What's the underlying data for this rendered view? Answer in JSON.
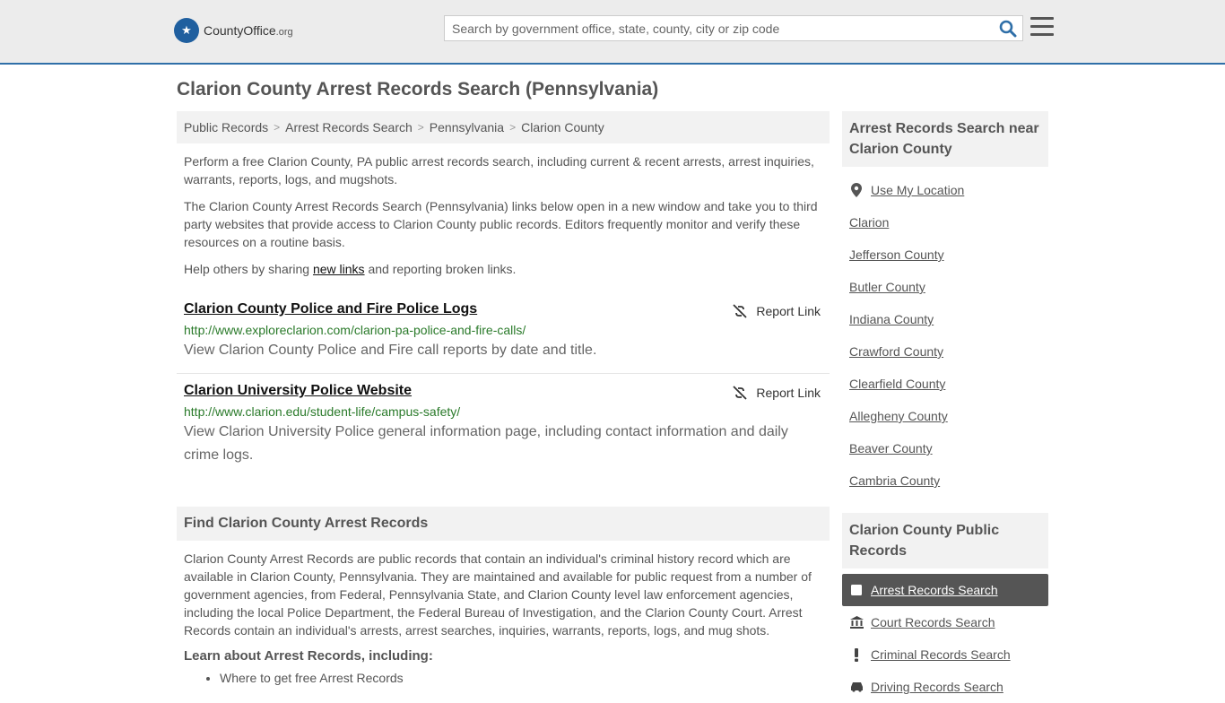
{
  "header": {
    "logo_name": "CountyOffice",
    "logo_tld": ".org",
    "search_placeholder": "Search by government office, state, county, city or zip code"
  },
  "page_title": "Clarion County Arrest Records Search (Pennsylvania)",
  "breadcrumbs": [
    "Public Records",
    "Arrest Records Search",
    "Pennsylvania",
    "Clarion County"
  ],
  "intro": {
    "p1": "Perform a free Clarion County, PA public arrest records search, including current & recent arrests, arrest inquiries, warrants, reports, logs, and mugshots.",
    "p2": "The Clarion County Arrest Records Search (Pennsylvania) links below open in a new window and take you to third party websites that provide access to Clarion County public records. Editors frequently monitor and verify these resources on a routine basis.",
    "p3_before": "Help others by sharing ",
    "p3_link": "new links",
    "p3_after": " and reporting broken links."
  },
  "records": [
    {
      "title": "Clarion County Police and Fire Police Logs",
      "url": "http://www.exploreclarion.com/clarion-pa-police-and-fire-calls/",
      "desc": "View Clarion County Police and Fire call reports by date and title.",
      "report_label": "Report Link"
    },
    {
      "title": "Clarion University Police Website",
      "url": "http://www.clarion.edu/student-life/campus-safety/",
      "desc": "View Clarion University Police general information page, including contact information and daily crime logs.",
      "report_label": "Report Link"
    }
  ],
  "find_section": {
    "heading": "Find Clarion County Arrest Records",
    "body": "Clarion County Arrest Records are public records that contain an individual's criminal history record which are available in Clarion County, Pennsylvania. They are maintained and available for public request from a number of government agencies, from Federal, Pennsylvania State, and Clarion County level law enforcement agencies, including the local Police Department, the Federal Bureau of Investigation, and the Clarion County Court. Arrest Records contain an individual's arrests, arrest searches, inquiries, warrants, reports, logs, and mug shots.",
    "learn_heading": "Learn about Arrest Records, including:",
    "learn_items": [
      "Where to get free Arrest Records"
    ]
  },
  "sidebar": {
    "near_heading": "Arrest Records Search near Clarion County",
    "use_location": "Use My Location",
    "near_items": [
      "Clarion",
      "Jefferson County",
      "Butler County",
      "Indiana County",
      "Crawford County",
      "Clearfield County",
      "Allegheny County",
      "Beaver County",
      "Cambria County"
    ],
    "public_heading": "Clarion County Public Records",
    "public_items": [
      {
        "label": "Arrest Records Search",
        "icon": "square-icon",
        "active": true
      },
      {
        "label": "Court Records Search",
        "icon": "courthouse-icon",
        "active": false
      },
      {
        "label": "Criminal Records Search",
        "icon": "exclamation-icon",
        "active": false
      },
      {
        "label": "Driving Records Search",
        "icon": "car-icon",
        "active": false
      }
    ]
  }
}
